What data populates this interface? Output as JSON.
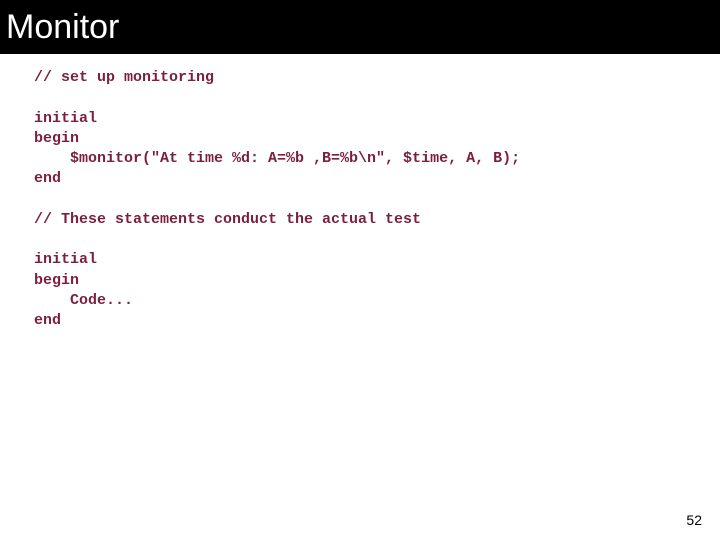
{
  "header": {
    "title": "Monitor"
  },
  "code": {
    "l01": "// set up monitoring",
    "l02": "",
    "l03": "initial",
    "l04": "begin",
    "l05": "    $monitor(\"At time %d: A=%b ,B=%b\\n\", $time, A, B);",
    "l06": "end",
    "l07": "",
    "l08": "// These statements conduct the actual test",
    "l09": "",
    "l10": "initial",
    "l11": "begin",
    "l12": "    Code...",
    "l13": "end"
  },
  "page_number": "52"
}
